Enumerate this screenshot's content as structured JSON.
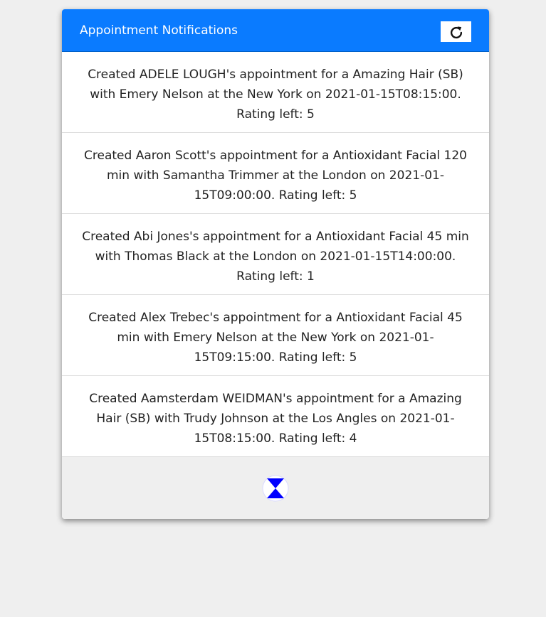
{
  "header": {
    "title": "Appointment Notifications",
    "refresh_icon": "refresh-icon"
  },
  "notifications": [
    "Created ADELE LOUGH's appointment for a Amazing Hair (SB) with Emery Nelson at the New York on 2021-01-15T08:15:00. Rating left: 5",
    "Created Aaron Scott's appointment for a Antioxidant Facial 120 min with Samantha Trimmer at the London on 2021-01-15T09:00:00. Rating left: 5",
    "Created Abi Jones's appointment for a Antioxidant Facial 45 min with Thomas Black at the London on 2021-01-15T14:00:00. Rating left: 1",
    "Created Alex Trebec's appointment for a Antioxidant Facial 45 min with Emery Nelson at the New York on 2021-01-15T09:15:00. Rating left: 5",
    "Created Aamsterdam WEIDMAN's appointment for a Amazing Hair (SB) with Trudy Johnson at the Los Angles on 2021-01-15T08:15:00. Rating left: 4"
  ],
  "footer": {
    "loading_icon": "hourglass-spinner-icon"
  },
  "colors": {
    "header_bg": "#0a7bff",
    "spinner": "#0000ff",
    "page_bg": "#efefef"
  }
}
